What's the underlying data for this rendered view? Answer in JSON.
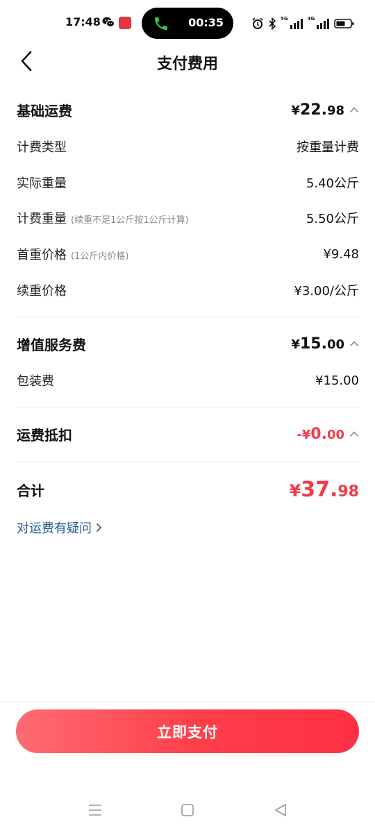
{
  "status_bar": {
    "time": "17:48",
    "call_duration": "00:35",
    "network_5g": "5G",
    "network_4g": "4G",
    "icons": [
      "wechat-icon",
      "app-notification-icon",
      "phone-icon",
      "alarm-icon",
      "bluetooth-icon",
      "signal-icon",
      "battery-icon"
    ]
  },
  "header": {
    "title": "支付费用"
  },
  "base_freight": {
    "title": "基础运费",
    "amount_yen": "¥",
    "amount_int": "22.",
    "amount_dec": "98",
    "items": [
      {
        "label": "计费类型",
        "note": "",
        "value": "按重量计费"
      },
      {
        "label": "实际重量",
        "note": "",
        "value": "5.40公斤"
      },
      {
        "label": "计费重量",
        "note": "(续重不足1公斤按1公斤计算)",
        "value": "5.50公斤"
      },
      {
        "label": "首重价格",
        "note": "(1公斤内价格)",
        "value": "¥9.48"
      },
      {
        "label": "续重价格",
        "note": "",
        "value": "¥3.00/公斤"
      }
    ]
  },
  "value_added": {
    "title": "增值服务费",
    "amount_yen": "¥",
    "amount_int": "15.",
    "amount_dec": "00",
    "items": [
      {
        "label": "包装费",
        "value": "¥15.00"
      }
    ]
  },
  "deduction": {
    "title": "运费抵扣",
    "amount_prefix": "-¥",
    "amount_int": "0.",
    "amount_dec": "00"
  },
  "total": {
    "label": "合计",
    "amount_yen": "¥",
    "amount_int": "37.",
    "amount_dec": "98"
  },
  "question_link": "对运费有疑问",
  "pay_button": "立即支付",
  "colors": {
    "accent_red": "#f23b4a",
    "link_blue": "#235a8f",
    "button_gradient_start": "#ff6b72",
    "button_gradient_end": "#ff2f43"
  }
}
